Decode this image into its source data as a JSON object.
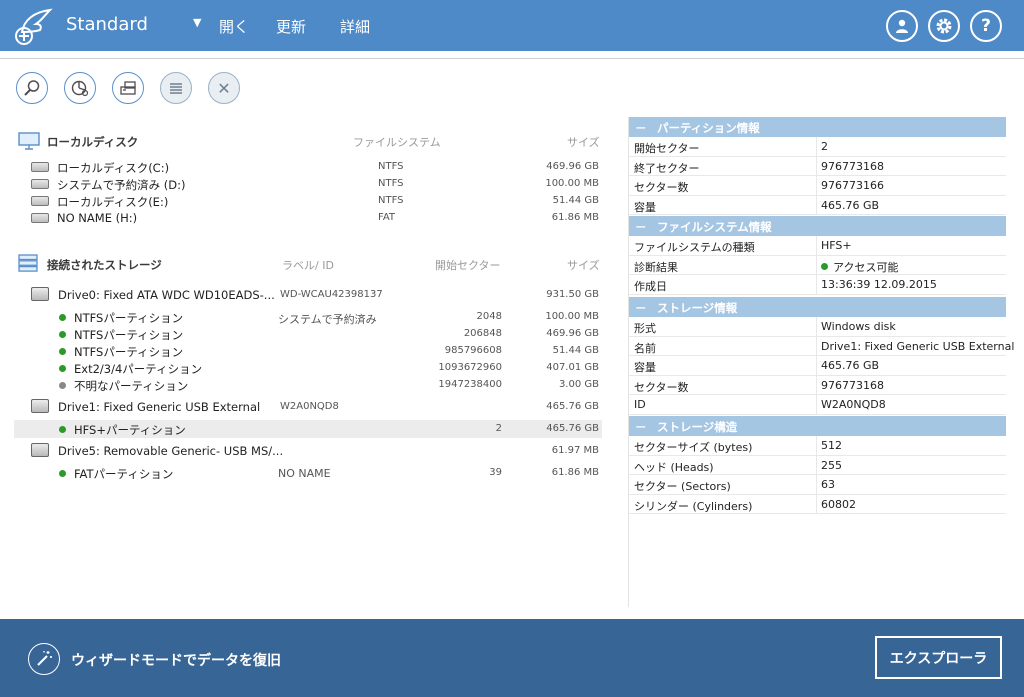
{
  "header": {
    "title": "Standard",
    "menu": [
      "開く",
      "更新",
      "詳細"
    ]
  },
  "colors": {
    "header": "#4e8ac8",
    "footer": "#376595",
    "table_head": "#a5c6e3",
    "status_green": "#2a9a2a",
    "status_gray": "#888888"
  },
  "local_disks": {
    "title": "ローカルディスク",
    "col_fs": "ファイルシステム",
    "col_size": "サイズ",
    "items": [
      {
        "name": "ローカルディスク(C:)",
        "fs": "NTFS",
        "size": "469.96 GB"
      },
      {
        "name": "システムで予約済み (D:)",
        "fs": "NTFS",
        "size": "100.00 MB"
      },
      {
        "name": "ローカルディスク(E:)",
        "fs": "NTFS",
        "size": "51.44 GB"
      },
      {
        "name": "NO NAME (H:)",
        "fs": "FAT",
        "size": "61.86 MB"
      }
    ]
  },
  "storage": {
    "title": "接続されたストレージ",
    "col_label": "ラベル/ ID",
    "col_start": "開始セクター",
    "col_size": "サイズ",
    "drives": [
      {
        "name": "Drive0: Fixed ATA WDC WD10EADS-...",
        "id": "WD-WCAU42398137",
        "size": "931.50 GB",
        "partitions": [
          {
            "name": "NTFSパーティション",
            "label": "システムで予約済み",
            "start": "2048",
            "size": "100.00 MB",
            "status": "ok"
          },
          {
            "name": "NTFSパーティション",
            "label": "",
            "start": "206848",
            "size": "469.96 GB",
            "status": "ok"
          },
          {
            "name": "NTFSパーティション",
            "label": "",
            "start": "985796608",
            "size": "51.44 GB",
            "status": "ok"
          },
          {
            "name": "Ext2/3/4パーティション",
            "label": "",
            "start": "1093672960",
            "size": "407.01 GB",
            "status": "ok"
          },
          {
            "name": "不明なパーティション",
            "label": "",
            "start": "1947238400",
            "size": "3.00 GB",
            "status": "unknown"
          }
        ]
      },
      {
        "name": "Drive1: Fixed Generic USB External",
        "id": "W2A0NQD8",
        "size": "465.76 GB",
        "partitions": [
          {
            "name": "HFS+パーティション",
            "label": "",
            "start": "2",
            "size": "465.76 GB",
            "status": "ok"
          }
        ]
      },
      {
        "name": "Drive5: Removable Generic- USB MS/...",
        "id": "",
        "size": "61.97 MB",
        "partitions": [
          {
            "name": "FATパーティション",
            "label": "NO NAME",
            "start": "39",
            "size": "61.86 MB",
            "status": "ok"
          }
        ]
      }
    ]
  },
  "properties": [
    {
      "title": "パーティション情報",
      "rows": [
        {
          "k": "開始セクター",
          "v": "2"
        },
        {
          "k": "終了セクター",
          "v": "976773168"
        },
        {
          "k": "セクター数",
          "v": "976773166"
        },
        {
          "k": "容量",
          "v": "465.76 GB"
        }
      ]
    },
    {
      "title": "ファイルシステム情報",
      "rows": [
        {
          "k": "ファイルシステムの種類",
          "v": "HFS+"
        },
        {
          "k": "診断結果",
          "v": "アクセス可能"
        },
        {
          "k": "作成日",
          "v": "13:36:39 12.09.2015"
        }
      ]
    },
    {
      "title": "ストレージ情報",
      "rows": [
        {
          "k": "形式",
          "v": "Windows disk"
        },
        {
          "k": "名前",
          "v": "Drive1: Fixed Generic USB External"
        },
        {
          "k": "容量",
          "v": "465.76 GB"
        },
        {
          "k": "セクター数",
          "v": "976773168"
        },
        {
          "k": "ID",
          "v": "W2A0NQD8"
        }
      ]
    },
    {
      "title": "ストレージ構造",
      "rows": [
        {
          "k": "セクターサイズ (bytes)",
          "v": "512"
        },
        {
          "k": "ヘッド (Heads)",
          "v": "255"
        },
        {
          "k": "セクター (Sectors)",
          "v": "63"
        },
        {
          "k": "シリンダー (Cylinders)",
          "v": "60802"
        }
      ]
    }
  ],
  "footer": {
    "wizard_label": "ウィザードモードでデータを復旧",
    "explorer_label": "エクスプローラ"
  },
  "icons": {
    "help": "?",
    "close": "✕",
    "section_minus": "－"
  }
}
